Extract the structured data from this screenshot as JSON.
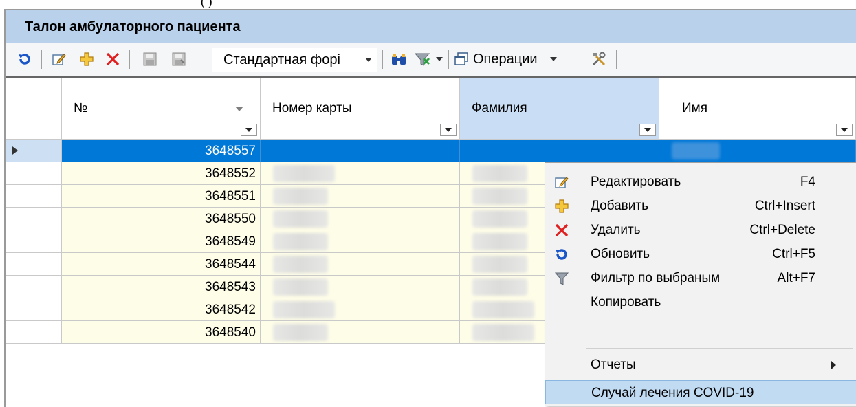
{
  "window": {
    "title": "Талон амбулаторного пациента"
  },
  "toolbar": {
    "form_select_value": "Стандартная форі",
    "operations_label": "Операции",
    "icons": [
      "refresh-icon",
      "edit-icon",
      "add-icon",
      "delete-icon",
      "save-icon",
      "save-all-icon",
      "binoculars-icon",
      "filter-icon",
      "operations-icon",
      "tools-icon"
    ]
  },
  "grid": {
    "columns": [
      "№",
      "Номер карты",
      "Фамилия",
      "Имя"
    ],
    "rows": [
      "3648557",
      "3648552",
      "3648551",
      "3648550",
      "3648549",
      "3648544",
      "3648543",
      "3648542",
      "3648540"
    ],
    "selected_row": 0,
    "sorted_column": "Фамилия"
  },
  "context_menu": {
    "items": [
      {
        "label": "Редактировать",
        "shortcut": "F4",
        "icon": "edit-icon"
      },
      {
        "label": "Добавить",
        "shortcut": "Ctrl+Insert",
        "icon": "add-icon"
      },
      {
        "label": "Удалить",
        "shortcut": "Ctrl+Delete",
        "icon": "delete-icon"
      },
      {
        "label": "Обновить",
        "shortcut": "Ctrl+F5",
        "icon": "refresh-icon"
      },
      {
        "label": "Фильтр по выбраным",
        "shortcut": "Alt+F7",
        "icon": "filter-icon"
      },
      {
        "label": "Копировать",
        "shortcut": "",
        "icon": ""
      },
      {
        "label": "Отчеты",
        "shortcut": "",
        "icon": "",
        "submenu": true
      },
      {
        "label": "Случай лечения COVID-19",
        "shortcut": "",
        "icon": "",
        "highlighted": true
      }
    ]
  },
  "colors": {
    "title_bg": "#b9d1ea",
    "selection": "#0078d7",
    "row_bg": "#fefde8",
    "menu_highlight": "#c1dbf3"
  }
}
